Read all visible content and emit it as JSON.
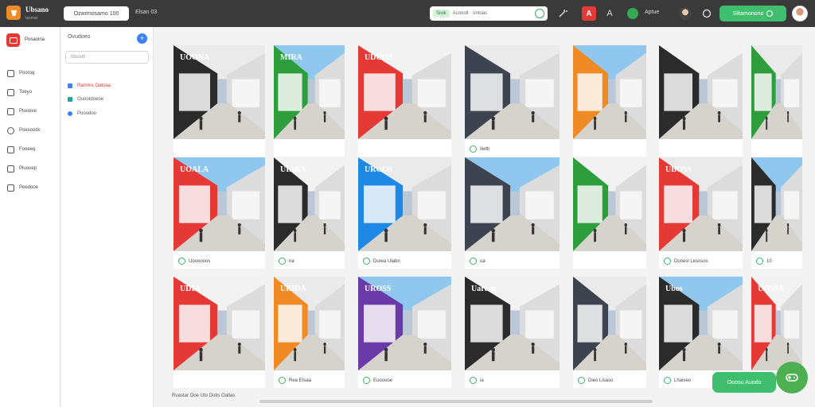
{
  "app": {
    "brand": "Ubsano",
    "brand_sub": "tasmat",
    "address": "Ozwrmosamo 100",
    "top_label": "Elsan 03",
    "top_text": "Aptue",
    "primary_button": "Slitamonono"
  },
  "search": {
    "tag": "Siwk",
    "placeholder": "Aconolt · ontoas"
  },
  "rail": {
    "title": "Posaoina",
    "items": [
      "Pooroq",
      "Toeyo",
      "Ptooeve",
      "Poesoods",
      "Fooeeq",
      "Pluooep",
      "Peedooe"
    ]
  },
  "panel": {
    "header": "Ovudoeo",
    "search_placeholder": "Ittoooh",
    "folders": [
      {
        "label": "Ramms Oatoaa",
        "color": "#3b82f6"
      },
      {
        "label": "Ouootdoeoe",
        "color": "#26a69a"
      },
      {
        "label": "Puoodoo",
        "color": "#3b82f6"
      }
    ]
  },
  "grid": {
    "rows": [
      [
        {
          "sign": "UOONA",
          "accent": "#2b2b2b"
        },
        {
          "sign": "MIRA",
          "accent": "#2e9e3c"
        },
        {
          "sign": "UDOOS",
          "accent": "#e53935"
        },
        {
          "sign": "",
          "accent": "#3d4450",
          "caption": "Iiwth"
        },
        {
          "sign": "",
          "accent": "#f08a24"
        },
        {
          "sign": "",
          "accent": "#2b2b2b"
        },
        {
          "sign": "",
          "accent": "#2e9e3c"
        }
      ],
      [
        {
          "sign": "UOALA",
          "accent": "#e53935",
          "caption": "Uoooooos"
        },
        {
          "sign": "UIARA",
          "accent": "#2b2b2b",
          "caption": "na"
        },
        {
          "sign": "UROOS",
          "accent": "#1e88e5",
          "caption": "Durea Ulabn"
        },
        {
          "sign": "",
          "accent": "#3d4450",
          "caption": "ua"
        },
        {
          "sign": "",
          "accent": "#2e9e3c"
        },
        {
          "sign": "UBOSS",
          "accent": "#e53935",
          "caption": "Dooesl Lesosos"
        },
        {
          "sign": "",
          "accent": "#2b2b2b",
          "caption": "10"
        }
      ],
      [
        {
          "sign": "UDIA",
          "accent": "#e53935"
        },
        {
          "sign": "URIDA",
          "accent": "#f08a24",
          "caption": "Rea Etsaa"
        },
        {
          "sign": "UROSS",
          "accent": "#6a3aa8",
          "caption": "Euooooe"
        },
        {
          "sign": "Uareen",
          "accent": "#2b2b2b",
          "caption": "ia"
        },
        {
          "sign": "",
          "accent": "#3d4450",
          "caption": "Dieo Lisaso"
        },
        {
          "sign": "Ubos",
          "accent": "#2b2b2b",
          "caption": "Lhaiveo"
        },
        {
          "sign": "UOSSA",
          "accent": "#e53935"
        }
      ]
    ]
  },
  "footer": {
    "text": "Ruastar Ooe Uto Dotis Oatlas"
  },
  "fab": {
    "label": "Oooou Auodo"
  },
  "colors": {
    "topbar": "#3a3a3a",
    "accent_green": "#3fbf6e",
    "accent_red": "#e53935"
  }
}
